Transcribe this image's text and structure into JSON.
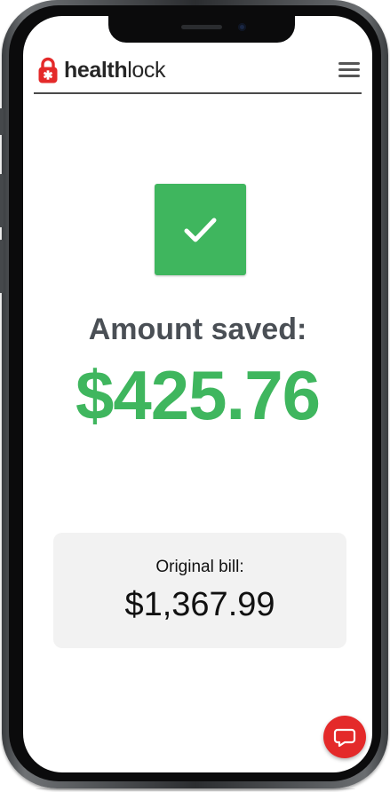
{
  "brand": {
    "bold": "health",
    "regular": "lock"
  },
  "result": {
    "saved_label": "Amount saved:",
    "saved_amount": "$425.76"
  },
  "bill": {
    "label": "Original bill:",
    "amount": "$1,367.99"
  },
  "colors": {
    "accent_green": "#3fb65e",
    "brand_red": "#e42a2a",
    "card_background": "#f2f2f2",
    "text_dark": "#4a4f55"
  },
  "icons": {
    "logo": "padlock-medical-cross-icon",
    "menu": "hamburger-menu-icon",
    "success": "checkmark-icon",
    "chat": "chat-bubble-icon"
  }
}
